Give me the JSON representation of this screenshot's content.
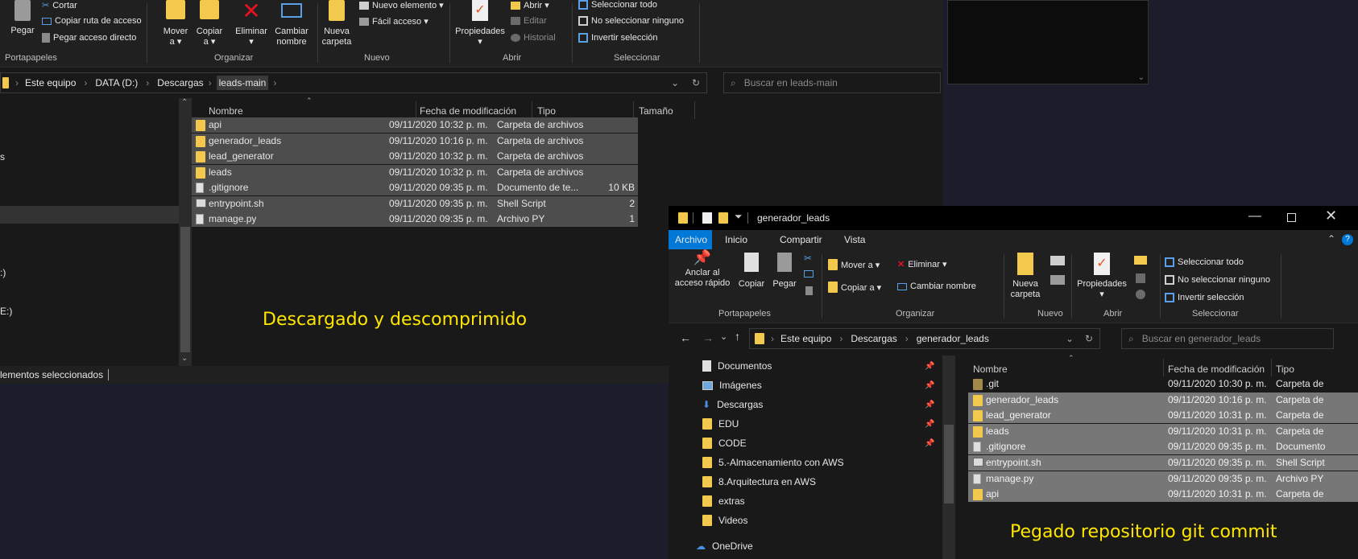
{
  "left": {
    "ribbon": {
      "cortar": "Cortar",
      "pegar": "Pegar",
      "copiar_ruta": "Copiar ruta de acceso",
      "pegar_acceso": "Pegar acceso directo",
      "portapapeles": "Portapapeles",
      "mover": "Mover",
      "mover_sub": "a ▾",
      "copiar": "Copiar",
      "copiar_sub": "a ▾",
      "eliminar": "Eliminar",
      "eliminar_sub": "▾",
      "cambiar": "Cambiar",
      "cambiar_sub": "nombre",
      "organizar": "Organizar",
      "nueva": "Nueva",
      "carpeta": "carpeta",
      "nuevo_elemento": "Nuevo elemento ▾",
      "facil_acceso": "Fácil acceso ▾",
      "nuevo": "Nuevo",
      "propiedades": "Propiedades",
      "prop_sub": "▾",
      "abrir_item": "Abrir ▾",
      "editar": "Editar",
      "historial": "Historial",
      "abrir": "Abrir",
      "sel_todo": "Seleccionar todo",
      "no_sel": "No seleccionar ninguno",
      "invertir": "Invertir selección",
      "seleccionar": "Seleccionar"
    },
    "breadcrumb": [
      "Este equipo",
      "DATA (D:)",
      "Descargas",
      "leads-main"
    ],
    "search_placeholder": "Buscar en leads-main",
    "columns": [
      "Nombre",
      "Fecha de modificación",
      "Tipo",
      "Tamaño"
    ],
    "files": [
      {
        "name": "api",
        "date": "09/11/2020 10:32 p. m.",
        "type": "Carpeta de archivos",
        "size": "",
        "icon": "folder"
      },
      {
        "name": "generador_leads",
        "date": "09/11/2020 10:16 p. m.",
        "type": "Carpeta de archivos",
        "size": "",
        "icon": "folder"
      },
      {
        "name": "lead_generator",
        "date": "09/11/2020 10:32 p. m.",
        "type": "Carpeta de archivos",
        "size": "",
        "icon": "folder"
      },
      {
        "name": "leads",
        "date": "09/11/2020 10:32 p. m.",
        "type": "Carpeta de archivos",
        "size": "",
        "icon": "folder"
      },
      {
        "name": ".gitignore",
        "date": "09/11/2020 09:35 p. m.",
        "type": "Documento de te...",
        "size": "10 KB",
        "icon": "file"
      },
      {
        "name": "entrypoint.sh",
        "date": "09/11/2020 09:35 p. m.",
        "type": "Shell Script",
        "size": "2",
        "icon": "shell"
      },
      {
        "name": "manage.py",
        "date": "09/11/2020 09:35 p. m.",
        "type": "Archivo PY",
        "size": "1",
        "icon": "file"
      }
    ],
    "nav_fragments": [
      "s",
      ":)",
      "E:)"
    ],
    "status": "lementos seleccionados",
    "overlay": "Descargado y descomprimido"
  },
  "right": {
    "title": "generador_leads",
    "tabs": [
      "Archivo",
      "Inicio",
      "Compartir",
      "Vista"
    ],
    "ribbon": {
      "anclar": "Anclar al",
      "anclar2": "acceso rápido",
      "copiar": "Copiar",
      "pegar": "Pegar",
      "portapapeles": "Portapapeles",
      "mover_a": "Mover a ▾",
      "copiar_a": "Copiar a ▾",
      "eliminar": "Eliminar ▾",
      "cambiar_nombre": "Cambiar nombre",
      "organizar": "Organizar",
      "nueva": "Nueva",
      "carpeta": "carpeta",
      "nuevo": "Nuevo",
      "propiedades": "Propiedades",
      "prop_sub": "▾",
      "abrir": "Abrir",
      "sel_todo": "Seleccionar todo",
      "no_sel": "No seleccionar ninguno",
      "invertir": "Invertir selección",
      "seleccionar": "Seleccionar"
    },
    "breadcrumb": [
      "Este equipo",
      "Descargas",
      "generador_leads"
    ],
    "search_placeholder": "Buscar en generador_leads",
    "nav": [
      {
        "label": "Documentos",
        "icon": "documents",
        "pinned": true
      },
      {
        "label": "Imágenes",
        "icon": "images",
        "pinned": true
      },
      {
        "label": "Descargas",
        "icon": "downloads",
        "pinned": true
      },
      {
        "label": "EDU",
        "icon": "folder",
        "pinned": true
      },
      {
        "label": "CODE",
        "icon": "folder",
        "pinned": true
      },
      {
        "label": "5.-Almacenamiento con AWS",
        "icon": "folder",
        "pinned": false
      },
      {
        "label": "8.Arquitectura en AWS",
        "icon": "folder",
        "pinned": false
      },
      {
        "label": "extras",
        "icon": "folder",
        "pinned": false
      },
      {
        "label": "Videos",
        "icon": "folder",
        "pinned": false
      },
      {
        "label": "OneDrive",
        "icon": "cloud",
        "pinned": false
      }
    ],
    "columns": [
      "Nombre",
      "Fecha de modificación",
      "Tipo"
    ],
    "files": [
      {
        "name": ".git",
        "date": "09/11/2020 10:30 p. m.",
        "type": "Carpeta de",
        "icon": "folder-dark",
        "selected": false
      },
      {
        "name": "generador_leads",
        "date": "09/11/2020 10:16 p. m.",
        "type": "Carpeta de",
        "icon": "folder",
        "selected": true
      },
      {
        "name": "lead_generator",
        "date": "09/11/2020 10:31 p. m.",
        "type": "Carpeta de",
        "icon": "folder",
        "selected": true
      },
      {
        "name": "leads",
        "date": "09/11/2020 10:31 p. m.",
        "type": "Carpeta de",
        "icon": "folder",
        "selected": true
      },
      {
        "name": ".gitignore",
        "date": "09/11/2020 09:35 p. m.",
        "type": "Documento",
        "icon": "file",
        "selected": true
      },
      {
        "name": "entrypoint.sh",
        "date": "09/11/2020 09:35 p. m.",
        "type": "Shell Script",
        "icon": "shell",
        "selected": true
      },
      {
        "name": "manage.py",
        "date": "09/11/2020 09:35 p. m.",
        "type": "Archivo PY",
        "icon": "file",
        "selected": true
      },
      {
        "name": "api",
        "date": "09/11/2020 10:31 p. m.",
        "type": "Carpeta de",
        "icon": "folder",
        "selected": true
      }
    ],
    "overlay": "Pegado repositorio git commit"
  },
  "colors": {
    "accent": "#0078d7",
    "overlay_text": "#ffe600",
    "folder": "#f2c94c",
    "delete_x": "#e81123"
  }
}
